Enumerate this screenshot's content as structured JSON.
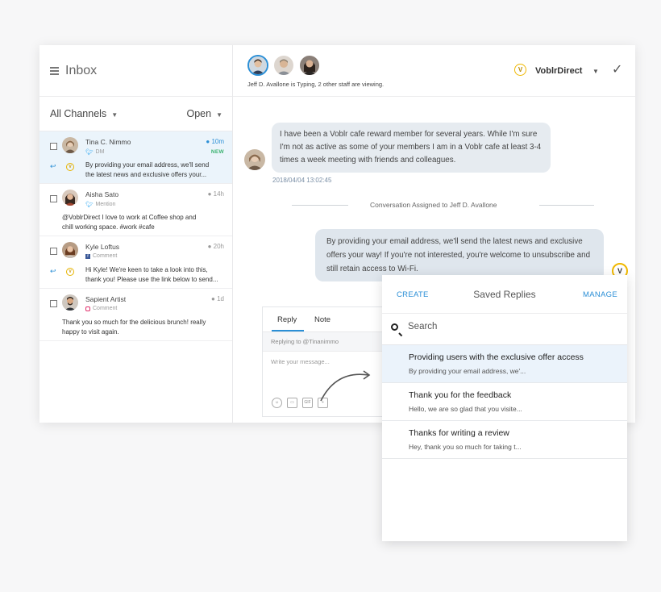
{
  "inbox": {
    "title": "Inbox",
    "channel_filter": "All Channels",
    "status_filter": "Open"
  },
  "conversations": [
    {
      "name": "Tina C. Nimmo",
      "source": "DM",
      "source_icon": "twitter-icon",
      "time": "10m",
      "badge": "NEW",
      "preview_1": "By providing your email address, we'll send",
      "preview_2": "the latest news and exclusive offers your..."
    },
    {
      "name": "Aisha Sato",
      "source": "Mention",
      "source_icon": "twitter-icon",
      "time": "14h",
      "preview_1": "@VoblrDirect I love to work at Coffee shop and",
      "preview_2": "chill working space. #work #cafe"
    },
    {
      "name": "Kyle Loftus",
      "source": "Comment",
      "source_icon": "facebook-icon",
      "time": "20h",
      "preview_1": "Hi Kyle! We're keen to take a look into this,",
      "preview_2": "thank you! Please use the link below to send..."
    },
    {
      "name": "Sapient Artist",
      "source": "Comment",
      "source_icon": "instagram-icon",
      "time": "1d",
      "preview_1": "Thank you so much for the delicious brunch! really",
      "preview_2": "happy to visit again."
    }
  ],
  "header": {
    "typing_status": "Jeff D. Avallone is Typing, 2 other staff are viewing.",
    "brand_logo": "V",
    "brand": "VoblrDirect"
  },
  "thread": {
    "incoming": "I have been a Voblr cafe reward member for several years. While I'm sure I'm not as active as some of your members I am in a Voblr cafe at least  3-4 times a week meeting with friends and colleagues.",
    "incoming_time": "2018/04/04 13:02:45",
    "assignment": "Conversation Assigned to Jeff D. Avallone",
    "outgoing": "By providing your email address, we'll send the latest news and exclusive offers your way! If you're not interested, you're welcome to unsubscribe and still retain access to Wi-Fi.",
    "agent_logo": "V"
  },
  "composer": {
    "tab_reply": "Reply",
    "tab_note": "Note",
    "replying_to": "Replying to @Tinanimmo",
    "placeholder": "Write your message...",
    "gif_label": "GIF"
  },
  "saved_replies": {
    "create": "CREATE",
    "title": "Saved Replies",
    "manage": "MANAGE",
    "search_placeholder": "Search",
    "items": [
      {
        "title": "Providing users with the exclusive offer access",
        "preview": "By providing your email address, we'..."
      },
      {
        "title": "Thank you for the feedback",
        "preview": "Hello, we are so glad that you visite..."
      },
      {
        "title": "Thanks for writing a review",
        "preview": "Hey, thank you so much for taking t..."
      }
    ]
  },
  "colors": {
    "accent": "#2b8fd6",
    "brand": "#f0b800",
    "new_badge": "#3cb371",
    "selected_row": "#ebf4fb"
  }
}
